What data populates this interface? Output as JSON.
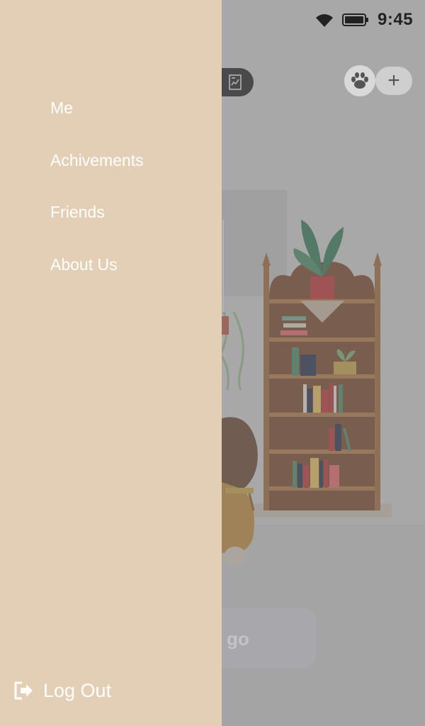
{
  "status_bar": {
    "time": "9:45"
  },
  "drawer": {
    "menu": [
      {
        "label": "Me"
      },
      {
        "label": "Achivements"
      },
      {
        "label": "Friends"
      },
      {
        "label": "About Us"
      }
    ],
    "logout_label": "Log Out"
  },
  "background": {
    "go_label": "go",
    "plus_label": "+"
  },
  "icons": {
    "wifi": "wifi-icon",
    "battery": "battery-icon",
    "report": "report-icon",
    "paw": "paw-icon",
    "plus": "plus-icon",
    "logout": "logout-icon"
  },
  "colors": {
    "drawer_background": "#e2cfb5",
    "menu_text": "#ffffff",
    "scrim": "#b8b8b8",
    "shelf_wood": "#b07a4a"
  }
}
